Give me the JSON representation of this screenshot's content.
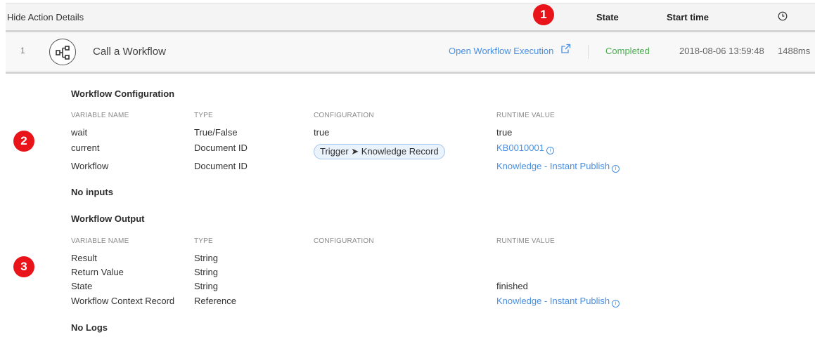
{
  "header": {
    "hide_label": "Hide Action Details",
    "state_label": "State",
    "start_time_label": "Start time",
    "clock_icon": "clock-icon"
  },
  "action_row": {
    "index": "1",
    "icon": "workflow-icon",
    "name": "Call a Workflow",
    "open_link": "Open Workflow Execution",
    "external_icon": "external-link-icon",
    "state": "Completed",
    "start_time": "2018-08-06 13:59:48",
    "duration": "1488ms",
    "state_color": "#4caf50"
  },
  "badges": [
    "1",
    "2",
    "3"
  ],
  "config": {
    "title": "Workflow Configuration",
    "columns": [
      "VARIABLE NAME",
      "TYPE",
      "CONFIGURATION",
      "RUNTIME VALUE"
    ],
    "rows": [
      {
        "name": "wait",
        "type": "True/False",
        "config": "true",
        "runtime": "true"
      },
      {
        "name": "current",
        "type": "Document ID",
        "config": "Trigger ➤ Knowledge Record",
        "runtime": "KB0010001"
      },
      {
        "name": "Workflow",
        "type": "Document ID",
        "config": "",
        "runtime": "Knowledge - Instant Publish"
      }
    ]
  },
  "no_inputs": "No inputs",
  "output": {
    "title": "Workflow Output",
    "columns": [
      "VARIABLE NAME",
      "TYPE",
      "CONFIGURATION",
      "RUNTIME VALUE"
    ],
    "rows": [
      {
        "name": "Result",
        "type": "String",
        "config": "",
        "runtime": ""
      },
      {
        "name": "Return Value",
        "type": "String",
        "config": "",
        "runtime": ""
      },
      {
        "name": "State",
        "type": "String",
        "config": "",
        "runtime": "finished"
      },
      {
        "name": "Workflow Context Record",
        "type": "Reference",
        "config": "",
        "runtime": "Knowledge - Instant Publish"
      }
    ]
  },
  "no_logs": "No Logs",
  "colors": {
    "link": "#4a90e2",
    "badge": "#e8141a",
    "completed": "#4caf50"
  }
}
